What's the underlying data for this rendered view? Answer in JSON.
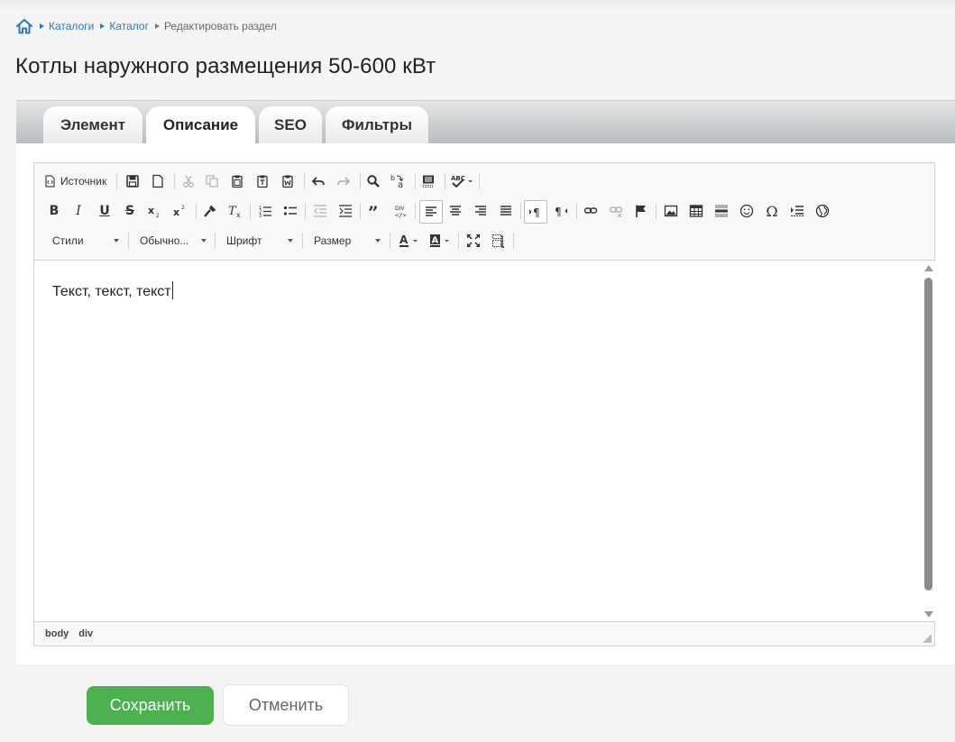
{
  "breadcrumb": {
    "home_icon": "home-icon",
    "items": [
      "Каталоги",
      "Каталог"
    ],
    "current": "Редактировать раздел"
  },
  "page_title": "Котлы наружного размещения 50-600 кВт",
  "tabs": [
    {
      "label": "Элемент",
      "active": false
    },
    {
      "label": "Описание",
      "active": true
    },
    {
      "label": "SEO",
      "active": false
    },
    {
      "label": "Фильтры",
      "active": false
    }
  ],
  "editor": {
    "source_label": "Источник",
    "combos": {
      "styles": "Стили",
      "format": "Обычно...",
      "font": "Шрифт",
      "size": "Размер"
    },
    "content_text": "Текст, текст, текст",
    "path": [
      "body",
      "div"
    ]
  },
  "buttons": {
    "save": "Сохранить",
    "cancel": "Отменить"
  },
  "colors": {
    "link": "#2a78c2",
    "save_bg": "#4caf50"
  }
}
